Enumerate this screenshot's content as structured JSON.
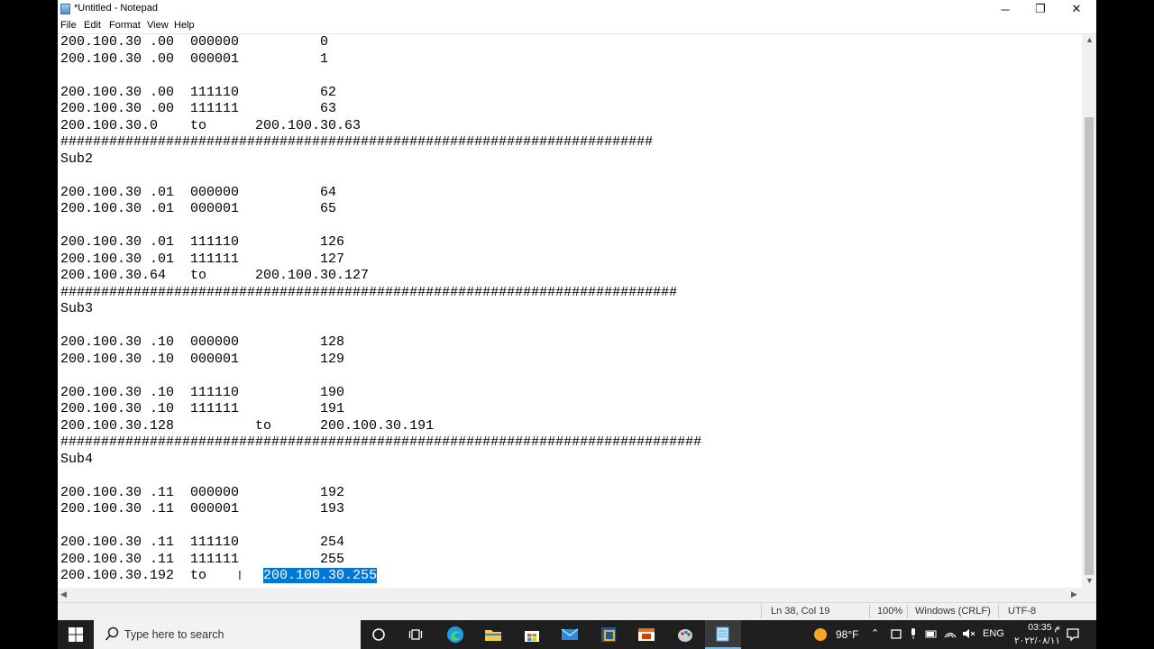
{
  "window": {
    "title": "*Untitled - Notepad",
    "controls": {
      "minimize": "─",
      "maximize": "❐",
      "close": "✕"
    }
  },
  "menu": [
    "File",
    "Edit",
    "Format",
    "View",
    "Help"
  ],
  "editor": {
    "lines": [
      "200.100.30 .00  000000          0",
      "200.100.30 .00  000001          1",
      "",
      "200.100.30 .00  111110          62",
      "200.100.30 .00  111111          63",
      "200.100.30.0    to      200.100.30.63",
      "#########################################################################",
      "Sub2",
      "",
      "200.100.30 .01  000000          64",
      "200.100.30 .01  000001          65",
      "",
      "200.100.30 .01  111110          126",
      "200.100.30 .01  111111          127",
      "200.100.30.64   to      200.100.30.127",
      "############################################################################",
      "Sub3",
      "",
      "200.100.30 .10  000000          128",
      "200.100.30 .10  000001          129",
      "",
      "200.100.30 .10  111110          190",
      "200.100.30 .10  111111          191",
      "200.100.30.128          to      200.100.30.191",
      "###############################################################################",
      "Sub4",
      "",
      "200.100.30 .11  000000          192",
      "200.100.30 .11  000001          193",
      "",
      "200.100.30 .11  111110          254",
      "200.100.30 .11  111111          255"
    ],
    "last_line_prefix": "200.100.30.192  to       ",
    "selected_text": "200.100.30.255"
  },
  "status": {
    "position": "Ln 38, Col 19",
    "zoom": "100%",
    "line_ending": "Windows (CRLF)",
    "encoding": "UTF-8"
  },
  "taskbar": {
    "search_placeholder": "Type here to search",
    "weather": "98°F",
    "language": "ENG",
    "time": "03:35 م",
    "date": "٢٠٢٢/٠٨/١١"
  },
  "colors": {
    "selection": "#0078d7",
    "taskbar": "#1f1f1f"
  }
}
